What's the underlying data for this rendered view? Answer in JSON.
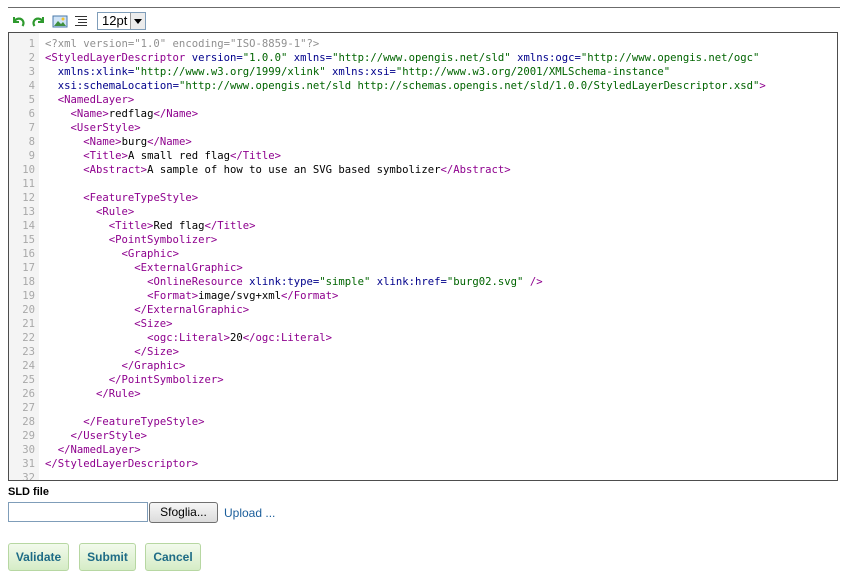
{
  "toolbar": {
    "icons": [
      "undo-icon",
      "redo-icon",
      "image-icon",
      "format-code-icon"
    ],
    "font_size": "12pt"
  },
  "editor": {
    "lines": [
      [
        [
          "pi",
          "<?xml version=\"1.0\" encoding=\"ISO-8859-1\"?>"
        ]
      ],
      [
        [
          "tag",
          "<StyledLayerDescriptor"
        ],
        [
          "",
          " "
        ],
        [
          "attr",
          "version="
        ],
        [
          "str",
          "\"1.0.0\""
        ],
        [
          "",
          " "
        ],
        [
          "attr",
          "xmlns="
        ],
        [
          "str",
          "\"http://www.opengis.net/sld\""
        ],
        [
          "",
          " "
        ],
        [
          "attr",
          "xmlns:ogc="
        ],
        [
          "str",
          "\"http://www.opengis.net/ogc\""
        ]
      ],
      [
        [
          "",
          "  "
        ],
        [
          "attr",
          "xmlns:xlink="
        ],
        [
          "str",
          "\"http://www.w3.org/1999/xlink\""
        ],
        [
          "",
          " "
        ],
        [
          "attr",
          "xmlns:xsi="
        ],
        [
          "str",
          "\"http://www.w3.org/2001/XMLSchema-instance\""
        ]
      ],
      [
        [
          "",
          "  "
        ],
        [
          "attr",
          "xsi:schemaLocation="
        ],
        [
          "str",
          "\"http://www.opengis.net/sld http://schemas.opengis.net/sld/1.0.0/StyledLayerDescriptor.xsd\""
        ],
        [
          "tag",
          ">"
        ]
      ],
      [
        [
          "",
          "  "
        ],
        [
          "tag",
          "<NamedLayer>"
        ]
      ],
      [
        [
          "",
          "    "
        ],
        [
          "tag",
          "<Name>"
        ],
        [
          "",
          "redflag"
        ],
        [
          "tag",
          "</Name>"
        ]
      ],
      [
        [
          "",
          "    "
        ],
        [
          "tag",
          "<UserStyle>"
        ]
      ],
      [
        [
          "",
          "      "
        ],
        [
          "tag",
          "<Name>"
        ],
        [
          "",
          "burg"
        ],
        [
          "tag",
          "</Name>"
        ]
      ],
      [
        [
          "",
          "      "
        ],
        [
          "tag",
          "<Title>"
        ],
        [
          "",
          "A small red flag"
        ],
        [
          "tag",
          "</Title>"
        ]
      ],
      [
        [
          "",
          "      "
        ],
        [
          "tag",
          "<Abstract>"
        ],
        [
          "",
          "A sample of how to use an SVG based symbolizer"
        ],
        [
          "tag",
          "</Abstract>"
        ]
      ],
      [],
      [
        [
          "",
          "      "
        ],
        [
          "tag",
          "<FeatureTypeStyle>"
        ]
      ],
      [
        [
          "",
          "        "
        ],
        [
          "tag",
          "<Rule>"
        ]
      ],
      [
        [
          "",
          "          "
        ],
        [
          "tag",
          "<Title>"
        ],
        [
          "",
          "Red flag"
        ],
        [
          "tag",
          "</Title>"
        ]
      ],
      [
        [
          "",
          "          "
        ],
        [
          "tag",
          "<PointSymbolizer>"
        ]
      ],
      [
        [
          "",
          "            "
        ],
        [
          "tag",
          "<Graphic>"
        ]
      ],
      [
        [
          "",
          "              "
        ],
        [
          "tag",
          "<ExternalGraphic>"
        ]
      ],
      [
        [
          "",
          "                "
        ],
        [
          "tag",
          "<OnlineResource"
        ],
        [
          "",
          " "
        ],
        [
          "attr",
          "xlink:type="
        ],
        [
          "str",
          "\"simple\""
        ],
        [
          "",
          " "
        ],
        [
          "attr",
          "xlink:href="
        ],
        [
          "str",
          "\"burg02.svg\""
        ],
        [
          "",
          " "
        ],
        [
          "tag",
          "/>"
        ]
      ],
      [
        [
          "",
          "                "
        ],
        [
          "tag",
          "<Format>"
        ],
        [
          "",
          "image/svg+xml"
        ],
        [
          "tag",
          "</Format>"
        ]
      ],
      [
        [
          "",
          "              "
        ],
        [
          "tag",
          "</ExternalGraphic>"
        ]
      ],
      [
        [
          "",
          "              "
        ],
        [
          "tag",
          "<Size>"
        ]
      ],
      [
        [
          "",
          "                "
        ],
        [
          "tag",
          "<ogc:Literal>"
        ],
        [
          "",
          "20"
        ],
        [
          "tag",
          "</ogc:Literal>"
        ]
      ],
      [
        [
          "",
          "              "
        ],
        [
          "tag",
          "</Size>"
        ]
      ],
      [
        [
          "",
          "            "
        ],
        [
          "tag",
          "</Graphic>"
        ]
      ],
      [
        [
          "",
          "          "
        ],
        [
          "tag",
          "</PointSymbolizer>"
        ]
      ],
      [
        [
          "",
          "        "
        ],
        [
          "tag",
          "</Rule>"
        ]
      ],
      [],
      [
        [
          "",
          "      "
        ],
        [
          "tag",
          "</FeatureTypeStyle>"
        ]
      ],
      [
        [
          "",
          "    "
        ],
        [
          "tag",
          "</UserStyle>"
        ]
      ],
      [
        [
          "",
          "  "
        ],
        [
          "tag",
          "</NamedLayer>"
        ]
      ],
      [
        [
          "tag",
          "</StyledLayerDescriptor>"
        ]
      ],
      []
    ]
  },
  "upload": {
    "label": "SLD file",
    "file_value": "",
    "browse_label": "Sfoglia...",
    "upload_link": "Upload ..."
  },
  "actions": {
    "validate": "Validate",
    "submit": "Submit",
    "cancel": "Cancel"
  },
  "colors": {
    "tag": "#8e008e",
    "attribute": "#00008b",
    "string": "#006400",
    "button_text": "#1e6b86",
    "button_bg": "#d5ecc6"
  }
}
